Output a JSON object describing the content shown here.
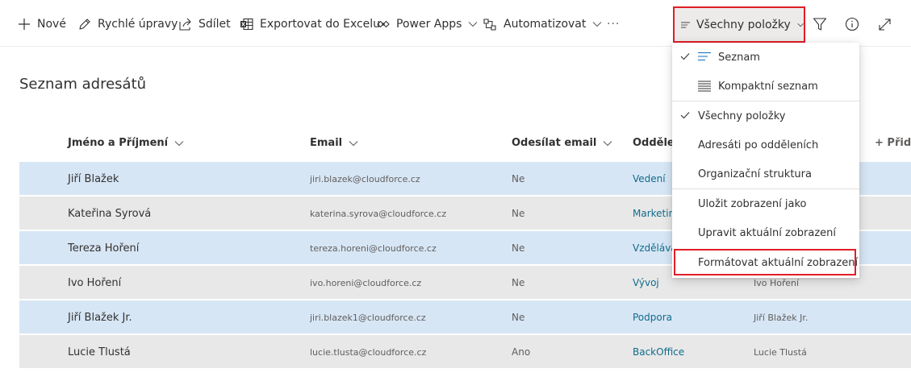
{
  "toolbar": {
    "new_label": "Nové",
    "quick_edit_label": "Rychlé úpravy",
    "share_label": "Sdílet",
    "export_label": "Exportovat do Excelu",
    "power_apps_label": "Power Apps",
    "automate_label": "Automatizovat",
    "more_label": "···",
    "view_selector_label": "Všechny položky"
  },
  "page": {
    "title": "Seznam adresátů"
  },
  "table": {
    "columns": {
      "name": "Jméno a Příjmení",
      "email": "Email",
      "send": "Odesílat email",
      "dept": "Odděler",
      "add": "+ Přida"
    },
    "rows": [
      {
        "name": "Jiří Blažek",
        "email": "jiri.blazek@cloudforce.cz",
        "send": "Ne",
        "dept": "Vedení",
        "manager": ""
      },
      {
        "name": "Kateřina Syrová",
        "email": "katerina.syrova@cloudforce.cz",
        "send": "Ne",
        "dept": "Marketing",
        "manager": ""
      },
      {
        "name": "Tereza Hoření",
        "email": "tereza.horeni@cloudforce.cz",
        "send": "Ne",
        "dept": "Vzdělává",
        "manager": ""
      },
      {
        "name": "Ivo Hoření",
        "email": "ivo.horeni@cloudforce.cz",
        "send": "Ne",
        "dept": "Vývoj",
        "manager": "Ivo Hoření"
      },
      {
        "name": "Jiří Blažek Jr.",
        "email": "jiri.blazek1@cloudforce.cz",
        "send": "Ne",
        "dept": "Podpora",
        "manager": "Jiří Blažek Jr."
      },
      {
        "name": "Lucie Tlustá",
        "email": "lucie.tlusta@cloudforce.cz",
        "send": "Ano",
        "dept": "BackOffice",
        "manager": "Lucie Tlustá"
      }
    ]
  },
  "view_menu": {
    "list": "Seznam",
    "compact_list": "Kompaktní seznam",
    "all_items": "Všechny položky",
    "by_department": "Adresáti po odděleních",
    "org_structure": "Organizační struktura",
    "save_view_as": "Uložit zobrazení jako",
    "edit_view": "Upravit aktuální zobrazení",
    "format_view": "Formátovat aktuální zobrazení"
  },
  "colors": {
    "highlight_border": "#e01e26",
    "selected_row": "#d7e6f5",
    "alt_row": "#e8e8e8",
    "dept_link": "#106c8c"
  },
  "icons": [
    "plus-icon",
    "pencil-icon",
    "share-icon",
    "excel-icon",
    "power-apps-icon",
    "flow-icon",
    "lines-icon",
    "filter-icon",
    "info-icon",
    "expand-icon",
    "check-icon",
    "chevron-down-icon"
  ]
}
